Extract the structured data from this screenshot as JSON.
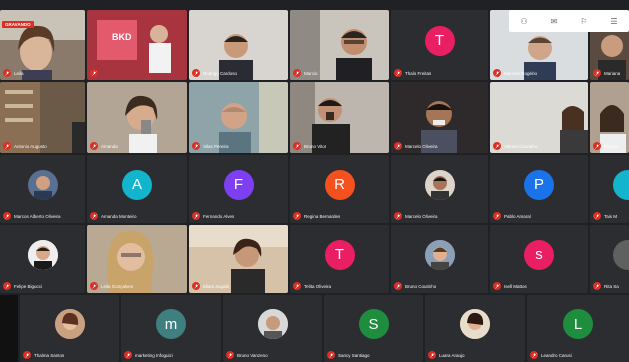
{
  "meeting": {
    "recording_badge": "GRAVANDO",
    "top_icons": [
      "people-icon",
      "chat-icon",
      "activities-icon",
      "info-icon"
    ],
    "top_glyphs": [
      "⚇",
      "✉",
      "⚐",
      "☰"
    ]
  },
  "tiles": [
    {
      "name": "Leila",
      "kind": "video",
      "color": "#9a8a7a"
    },
    {
      "name": "",
      "kind": "video",
      "color": "#b04050"
    },
    {
      "name": "Rodrigo Cardoso",
      "kind": "video",
      "color": "#c8c4bd"
    },
    {
      "name": "Marcio",
      "kind": "video",
      "color": "#a9a39a"
    },
    {
      "name": "Thaís Freitas",
      "kind": "avatar",
      "letter": "T",
      "color": "#e91e63"
    },
    {
      "name": "Marcelo Rogério",
      "kind": "video",
      "color": "#c8ccd0"
    },
    {
      "name": "Mariana",
      "kind": "video",
      "color": "#5a4a3f"
    },
    {
      "name": "Antonio Augusto",
      "kind": "video",
      "color": "#6b5a48"
    },
    {
      "name": "Amanda",
      "kind": "video",
      "color": "#8b7a6a"
    },
    {
      "name": "Silas Pereira",
      "kind": "video",
      "color": "#8a9aa0"
    },
    {
      "name": "Bruno Vitor",
      "kind": "video",
      "color": "#7a7570"
    },
    {
      "name": "Marcelo Oliveira",
      "kind": "video",
      "color": "#3a3538"
    },
    {
      "name": "Vittoria Carvalho",
      "kind": "video",
      "color": "#d0cfcc"
    },
    {
      "name": "Marina",
      "kind": "video",
      "color": "#b0a090"
    },
    {
      "name": "Marcos Alberto Oliveira",
      "kind": "photo",
      "color": "#5a7090"
    },
    {
      "name": "Amanda Monteiro",
      "kind": "avatar",
      "letter": "A",
      "color": "#12b5cb"
    },
    {
      "name": "Fernando Alves",
      "kind": "avatar",
      "letter": "F",
      "color": "#7e3ff2"
    },
    {
      "name": "Regina Bernardes",
      "kind": "avatar",
      "letter": "R",
      "color": "#f4511e"
    },
    {
      "name": "Marcelo Oliveira",
      "kind": "photo",
      "color": "#4a3a30"
    },
    {
      "name": "Pablo Amaral",
      "kind": "avatar",
      "letter": "P",
      "color": "#1a73e8"
    },
    {
      "name": "Tais M",
      "kind": "avatar",
      "letter": "",
      "color": "#12b5cb"
    },
    {
      "name": "Felipe Bigucci",
      "kind": "photo",
      "color": "#e0e0e0"
    },
    {
      "name": "Leila Gonçalves",
      "kind": "video",
      "color": "#b9a892"
    },
    {
      "name": "Eliani Zugaib",
      "kind": "video",
      "color": "#a89078"
    },
    {
      "name": "Telita Oliveira",
      "kind": "avatar",
      "letter": "T",
      "color": "#e91e63"
    },
    {
      "name": "Bruno Coutinho",
      "kind": "photo",
      "color": "#c08060"
    },
    {
      "name": "Isell Mattos",
      "kind": "avatar",
      "letter": "s",
      "color": "#e91e63"
    },
    {
      "name": "Rita Sa",
      "kind": "photo",
      "color": "#606060"
    },
    {
      "name": "Thalma Santos",
      "kind": "photo",
      "color": "#a07060"
    },
    {
      "name": "marketing Infoguizi",
      "kind": "avatar",
      "letter": "m",
      "color": "#3f7f80"
    },
    {
      "name": "Bruno Vanzeno",
      "kind": "photo",
      "color": "#b0b0b0"
    },
    {
      "name": "Sancy Santiago",
      "kind": "avatar",
      "letter": "S",
      "color": "#1e8e3e"
    },
    {
      "name": "Luara Araujo",
      "kind": "photo",
      "color": "#c09070"
    },
    {
      "name": "Leandro Carusi",
      "kind": "avatar",
      "letter": "L",
      "color": "#1e8e3e"
    }
  ]
}
